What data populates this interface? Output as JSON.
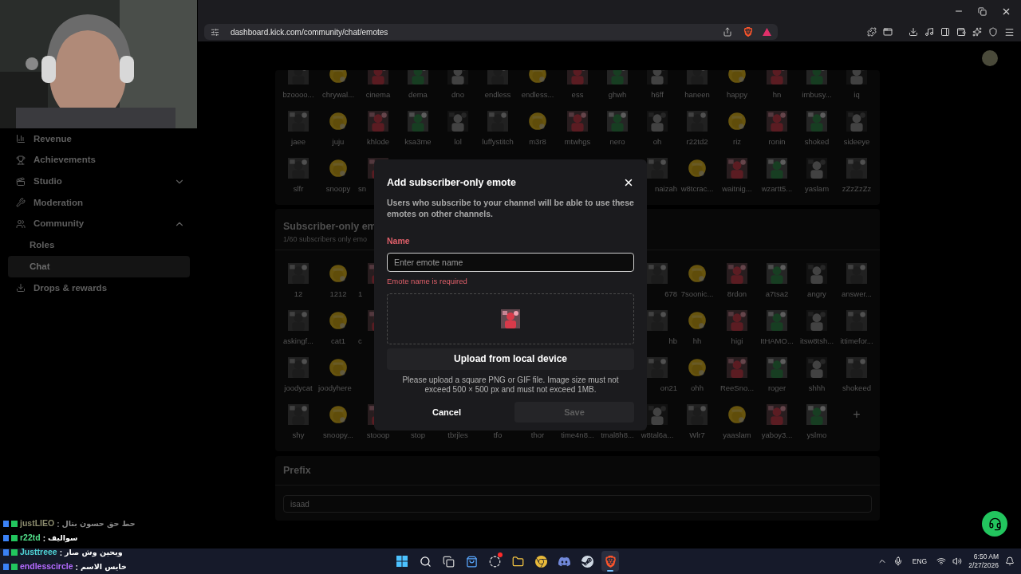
{
  "browser": {
    "url": "dashboard.kick.com/community/chat/emotes"
  },
  "sidebar": {
    "items": [
      {
        "label": "Revenue",
        "selected": false
      },
      {
        "label": "Achievements",
        "selected": false
      },
      {
        "label": "Studio",
        "selected": false,
        "expanded": false
      },
      {
        "label": "Moderation",
        "selected": false
      },
      {
        "label": "Community",
        "selected": false,
        "expanded": true,
        "children": [
          {
            "label": "Roles",
            "selected": false
          },
          {
            "label": "Chat",
            "selected": true
          }
        ]
      },
      {
        "label": "Drops & rewards",
        "selected": false
      }
    ]
  },
  "emotes": {
    "rows": [
      {
        "left": [
          {
            "name": "bzoooo..."
          },
          {
            "name": "chrywal..."
          },
          {
            "name": "cinema"
          },
          {
            "name": "dema"
          },
          {
            "name": "dno"
          },
          {
            "name": "endless"
          },
          {
            "name": "endless..."
          },
          {
            "name": "ess"
          },
          {
            "name": "ghwh"
          },
          {
            "name": "h6ff"
          },
          {
            "name": "haneen"
          },
          {
            "name": "happy"
          },
          {
            "name": "hn"
          },
          {
            "name": "imbusy..."
          },
          {
            "name": "iq"
          }
        ],
        "right": []
      },
      {
        "left": [
          {
            "name": "jaee"
          },
          {
            "name": "juju"
          },
          {
            "name": "khlode"
          },
          {
            "name": "ksa3me"
          },
          {
            "name": "lol"
          },
          {
            "name": "luffystitch"
          },
          {
            "name": "m3r8"
          },
          {
            "name": "mtwhgs"
          },
          {
            "name": "nero"
          },
          {
            "name": "oh"
          },
          {
            "name": "r22td2"
          },
          {
            "name": "riz"
          },
          {
            "name": "ronin"
          },
          {
            "name": "shoked"
          },
          {
            "name": "sideeye"
          }
        ],
        "right": []
      },
      {
        "left": [
          {
            "name": "slfr"
          },
          {
            "name": "snoopy"
          },
          {
            "name": "sn"
          }
        ],
        "right": [
          {
            "name": "naizah"
          },
          {
            "name": "w8tcrac..."
          },
          {
            "name": "waitnig..."
          },
          {
            "name": "wzartt5..."
          },
          {
            "name": "yaslam"
          },
          {
            "name": "zZzZzZz"
          }
        ]
      }
    ]
  },
  "subscriber_emotes": {
    "title": "Subscriber-only em",
    "subtitle": "1/60 subscribers only emo",
    "add_button": "+",
    "rows": [
      {
        "left": [
          {
            "name": "12"
          },
          {
            "name": "1212"
          },
          {
            "name": "1"
          }
        ],
        "right": [
          {
            "name": "678"
          },
          {
            "name": "7soonic..."
          },
          {
            "name": "8rdon"
          },
          {
            "name": "a7tsa2"
          },
          {
            "name": "angry"
          },
          {
            "name": "answer..."
          }
        ]
      },
      {
        "left": [
          {
            "name": "askingf..."
          },
          {
            "name": "cat1"
          },
          {
            "name": "c"
          }
        ],
        "right": [
          {
            "name": "hb"
          },
          {
            "name": "hh"
          },
          {
            "name": "higi"
          },
          {
            "name": "ItHAMO..."
          },
          {
            "name": "itsw8tsh..."
          },
          {
            "name": "ittimefor..."
          }
        ]
      },
      {
        "left": [
          {
            "name": "joodycat"
          },
          {
            "name": "joodyhere"
          }
        ],
        "right": [
          {
            "name": "on21"
          },
          {
            "name": "ohh"
          },
          {
            "name": "ReeSno..."
          },
          {
            "name": "roger"
          },
          {
            "name": "shhh"
          },
          {
            "name": "shokeed"
          }
        ]
      },
      {
        "left": [
          {
            "name": "shy"
          },
          {
            "name": "snoopy..."
          },
          {
            "name": "stooop"
          },
          {
            "name": "stop"
          },
          {
            "name": "tbrjles"
          },
          {
            "name": "tfo"
          },
          {
            "name": "thor"
          },
          {
            "name": "time4n8..."
          },
          {
            "name": "tmal8h8..."
          },
          {
            "name": "w8tal6a..."
          },
          {
            "name": "Wlr7"
          },
          {
            "name": "yaaslam"
          },
          {
            "name": "yaboy3..."
          },
          {
            "name": "yslmo"
          }
        ],
        "right": []
      }
    ]
  },
  "prefix": {
    "title": "Prefix",
    "value": "isaad"
  },
  "modal": {
    "title": "Add subscriber-only emote",
    "description": "Users who subscribe to your channel will be able to use these emotes on other channels.",
    "name_label": "Name",
    "placeholder": "Enter emote name",
    "error": "Emote name is required",
    "upload_button": "Upload from local device",
    "help": "Please upload a square PNG or GIF file. Image size must not exceed 500 × 500 px and must not exceed 1MB.",
    "cancel": "Cancel",
    "save": {
      "label": "Save",
      "disabled": true
    }
  },
  "chat": {
    "messages": [
      {
        "name": "justLIEO",
        "color": "#8c8c6e",
        "separator": ":",
        "text": "حط حق حسون بتال",
        "faded": true
      },
      {
        "name": "r22td",
        "color": "#53e08a",
        "separator": ":",
        "text": "سواليف",
        "faded": false
      },
      {
        "name": "Justtreee",
        "color": "#4fd3d6",
        "separator": ":",
        "text": "ويحين وش صار",
        "faded": false
      },
      {
        "name": "endlesscircle",
        "color": "#b46bff",
        "separator": ":",
        "text": "خايس الاسم",
        "faded": false
      }
    ]
  },
  "taskbar": {
    "apps": [
      {
        "active": false,
        "badge": false
      },
      {
        "active": false,
        "badge": false
      },
      {
        "active": false,
        "badge": false
      },
      {
        "active": false,
        "badge": false
      },
      {
        "active": false,
        "badge": true
      },
      {
        "active": false,
        "badge": false
      },
      {
        "active": false,
        "badge": false
      },
      {
        "active": false,
        "badge": false
      },
      {
        "active": false,
        "badge": false
      },
      {
        "active": true,
        "badge": false
      }
    ],
    "language": "ENG",
    "time": "6:50 AM",
    "date": "2/27/2026"
  }
}
